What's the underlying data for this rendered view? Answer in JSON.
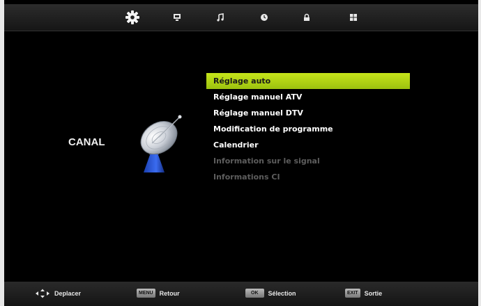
{
  "tabs": [
    {
      "icon": "gear-icon",
      "active": true
    },
    {
      "icon": "tv-icon",
      "active": false
    },
    {
      "icon": "music-note-icon",
      "active": false
    },
    {
      "icon": "clock-icon",
      "active": false
    },
    {
      "icon": "lock-icon",
      "active": false
    },
    {
      "icon": "grid-icon",
      "active": false
    }
  ],
  "section": {
    "title": "CANAL",
    "icon": "satellite-dish-icon"
  },
  "menu": {
    "items": [
      {
        "label": "Réglage auto",
        "state": "selected"
      },
      {
        "label": "Réglage manuel ATV",
        "state": "enabled"
      },
      {
        "label": "Réglage manuel DTV",
        "state": "enabled"
      },
      {
        "label": "Modification de programme",
        "state": "enabled"
      },
      {
        "label": "Calendrier",
        "state": "enabled"
      },
      {
        "label": "Information sur le signal",
        "state": "disabled"
      },
      {
        "label": "Informations CI",
        "state": "disabled"
      }
    ]
  },
  "hints": {
    "move": {
      "label": "Deplacer"
    },
    "back": {
      "key": "MENU",
      "label": "Retour"
    },
    "select": {
      "key": "OK",
      "label": "Sélection"
    },
    "exit": {
      "key": "EXIT",
      "label": "Sortie"
    }
  },
  "colors": {
    "highlight": "#b4d514",
    "background": "#000000",
    "disabled_text": "#5d5d5d"
  }
}
